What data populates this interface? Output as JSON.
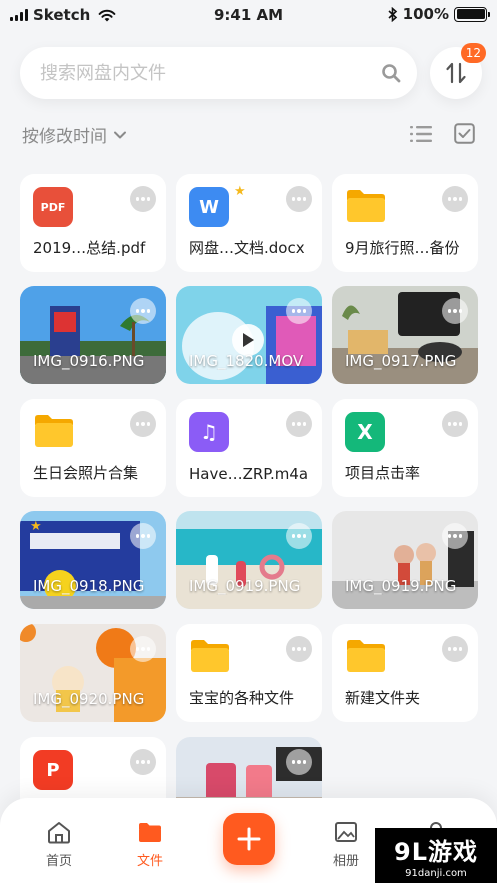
{
  "status_bar": {
    "carrier": "Sketch",
    "time": "9:41 AM",
    "battery": "100%"
  },
  "search": {
    "placeholder": "搜索网盘内文件",
    "icon": "search-icon"
  },
  "sort_button": {
    "icon": "sort-arrows-icon",
    "badge": "12"
  },
  "toolbar": {
    "sort_label": "按修改时间",
    "list_view_icon": "list-view-icon",
    "select_icon": "checkbox-icon"
  },
  "colors": {
    "accent": "#ff5a1f",
    "badge": "#ff6a26",
    "folder": "#ffc72c",
    "pdf": "#e8503a",
    "word": "#3d8bf2",
    "music": "#8b5cf6",
    "excel": "#14b87a",
    "ppt": "#f23c24"
  },
  "files": [
    {
      "name": "2019…总结.pdf",
      "type": "pdf",
      "icon_label": "PDF"
    },
    {
      "name": "网盘…文档.docx",
      "type": "word",
      "icon_label": "W",
      "starred": true
    },
    {
      "name": "9月旅行照…备份",
      "type": "folder"
    },
    {
      "name": "IMG_0916.PNG",
      "type": "photo"
    },
    {
      "name": "IMG_1820.MOV",
      "type": "video"
    },
    {
      "name": "IMG_0917.PNG",
      "type": "photo"
    },
    {
      "name": "生日会照片合集",
      "type": "folder"
    },
    {
      "name": "Have…ZRP.m4a",
      "type": "music",
      "icon_label": "♫"
    },
    {
      "name": "项目点击率",
      "type": "excel",
      "icon_label": "X"
    },
    {
      "name": "IMG_0918.PNG",
      "type": "photo"
    },
    {
      "name": "IMG_0919.PNG",
      "type": "photo"
    },
    {
      "name": "IMG_0919.PNG",
      "type": "photo"
    },
    {
      "name": "IMG_0920.PNG",
      "type": "photo"
    },
    {
      "name": "宝宝的各种文件",
      "type": "folder"
    },
    {
      "name": "新建文件夹",
      "type": "folder"
    },
    {
      "name": "",
      "type": "ppt",
      "icon_label": "P"
    },
    {
      "name": "",
      "type": "photo"
    }
  ],
  "tab_bar": {
    "home": "首页",
    "files": "文件",
    "add_icon": "plus-icon",
    "album": "相册"
  },
  "watermark": {
    "main": "9L游戏",
    "sub": "91danji.com"
  }
}
